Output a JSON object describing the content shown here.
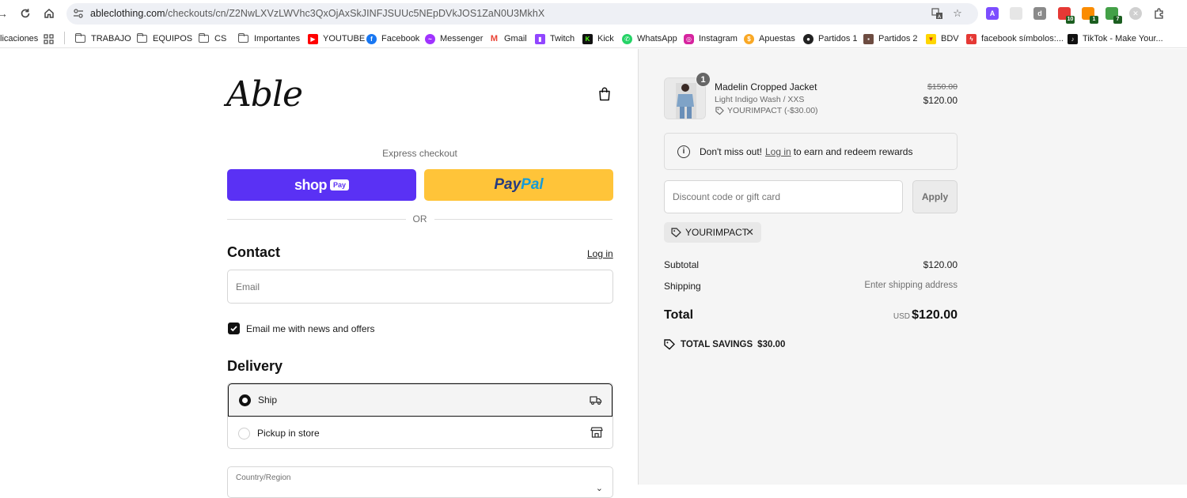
{
  "browser": {
    "url_host": "ableclothing.com",
    "url_path": "/checkouts/cn/Z2NwLXVzLWVhc3QxOjAxSkJINFJSUUc5NEpDVkJOS1ZaN0U3MkhX",
    "ext_badges": [
      "10",
      "1",
      "7"
    ],
    "ext_icons": [
      "A",
      "d"
    ]
  },
  "bookmarks": [
    {
      "label": "licaciones"
    },
    {
      "label": "TRABAJO"
    },
    {
      "label": "EQUIPOS"
    },
    {
      "label": "CS"
    },
    {
      "label": "Importantes"
    },
    {
      "label": "YOUTUBE"
    },
    {
      "label": "Facebook"
    },
    {
      "label": "Messenger"
    },
    {
      "label": "Gmail"
    },
    {
      "label": "Twitch"
    },
    {
      "label": "Kick"
    },
    {
      "label": "WhatsApp"
    },
    {
      "label": "Instagram"
    },
    {
      "label": "Apuestas"
    },
    {
      "label": "Partidos 1"
    },
    {
      "label": "Partidos 2"
    },
    {
      "label": "BDV"
    },
    {
      "label": "facebook símbolos:..."
    },
    {
      "label": "TikTok - Make Your..."
    }
  ],
  "brand": {
    "logo_text": "Able"
  },
  "express": {
    "label": "Express checkout",
    "shop_text": "shop",
    "shop_pay_pill": "Pay",
    "paypal_a": "Pay",
    "paypal_b": "Pal",
    "or_text": "OR"
  },
  "contact": {
    "title": "Contact",
    "login": "Log in",
    "email_placeholder": "Email",
    "newsletter_label": "Email me with news and offers",
    "newsletter_checked": true
  },
  "delivery": {
    "title": "Delivery",
    "options": [
      {
        "label": "Ship",
        "selected": true
      },
      {
        "label": "Pickup in store",
        "selected": false
      }
    ],
    "country_label": "Country/Region"
  },
  "order": {
    "item": {
      "quantity": "1",
      "name": "Madelin Cropped Jacket",
      "variant": "Light Indigo Wash / XXS",
      "discount": "YOURIMPACT (-$30.00)",
      "price_original": "$150.00",
      "price": "$120.00"
    },
    "rewards": {
      "prefix": "Don't miss out!",
      "link": "Log in",
      "suffix": "to earn and redeem rewards"
    },
    "discount_placeholder": "Discount code or gift card",
    "apply_label": "Apply",
    "applied_code": "YOURIMPACT",
    "subtotal_label": "Subtotal",
    "subtotal_value": "$120.00",
    "shipping_label": "Shipping",
    "shipping_value": "Enter shipping address",
    "total_label": "Total",
    "total_currency": "USD",
    "total_value": "$120.00",
    "savings_label": "TOTAL SAVINGS",
    "savings_value": "$30.00"
  },
  "colors": {
    "shop_pay": "#5a31f4",
    "paypal": "#ffc439",
    "summary_bg": "#f5f5f5"
  }
}
